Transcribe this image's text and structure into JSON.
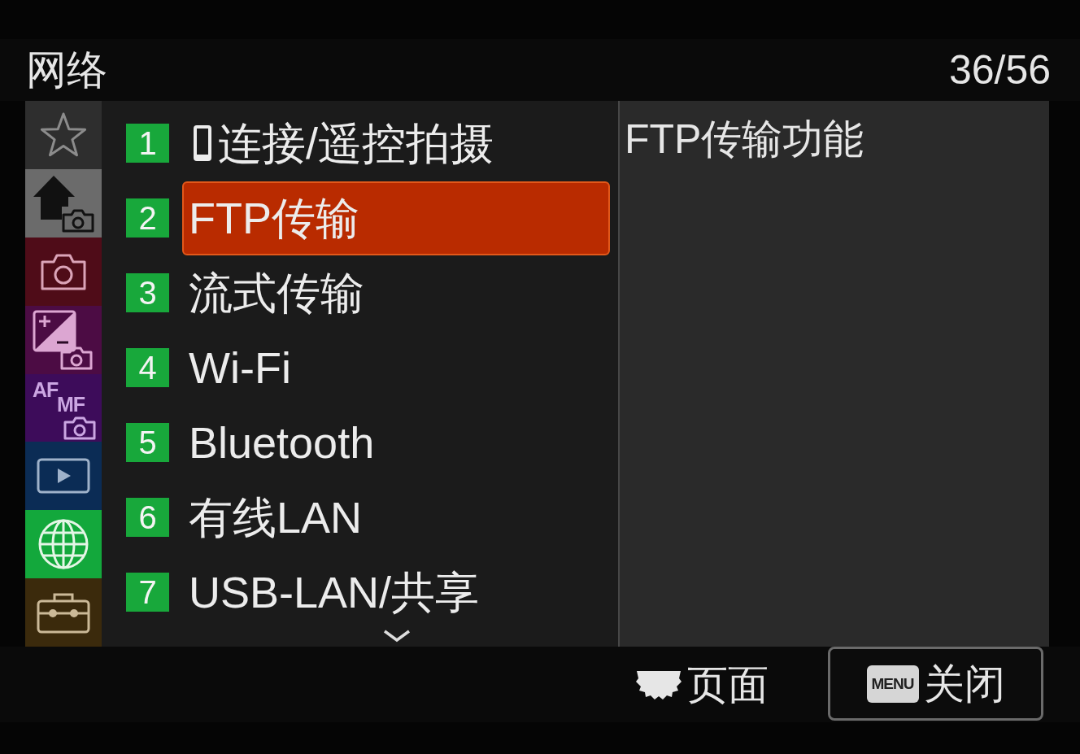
{
  "header": {
    "title": "网络",
    "page_counter": "36/56"
  },
  "category_tabs": [
    {
      "kind": "star",
      "color": "#2e2e2e",
      "selected": false
    },
    {
      "kind": "home",
      "color": "#6b6b6b",
      "selected": false
    },
    {
      "kind": "camera",
      "color": "#4f0c18",
      "selected": false
    },
    {
      "kind": "exposure",
      "color": "#4c0c44",
      "selected": false
    },
    {
      "kind": "focus",
      "color": "#3d0c5a",
      "selected": false,
      "labels": [
        "AF",
        "MF"
      ]
    },
    {
      "kind": "playback",
      "color": "#0b2c55",
      "selected": false
    },
    {
      "kind": "network",
      "color": "#13a83c",
      "selected": true
    },
    {
      "kind": "setup",
      "color": "#3b2a0c",
      "selected": false
    }
  ],
  "menu_items": [
    {
      "kind": "phone",
      "number": "1",
      "label": "连接/遥控拍摄",
      "selected": false
    },
    {
      "kind": "text",
      "number": "2",
      "label": "FTP传输",
      "selected": true
    },
    {
      "kind": "text",
      "number": "3",
      "label": "流式传输",
      "selected": false
    },
    {
      "kind": "text",
      "number": "4",
      "label": "Wi-Fi",
      "selected": false
    },
    {
      "kind": "text",
      "number": "5",
      "label": "Bluetooth",
      "selected": false
    },
    {
      "kind": "text",
      "number": "6",
      "label": "有线LAN",
      "selected": false
    },
    {
      "kind": "text",
      "number": "7",
      "label": "USB-LAN/共享",
      "selected": false
    }
  ],
  "more_below": true,
  "description": "FTP传输功能",
  "footer": {
    "page_hint": "页面",
    "close_button": {
      "key": "MENU",
      "label": "关闭"
    }
  }
}
